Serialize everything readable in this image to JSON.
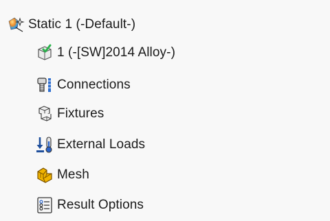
{
  "tree": {
    "root": {
      "label": "Static 1 (-Default-)",
      "icon": "static-study-icon"
    },
    "items": [
      {
        "label": "1 (-[SW]2014 Alloy-)",
        "icon": "part-material-check-icon"
      },
      {
        "label": "Connections",
        "icon": "connections-bolt-icon"
      },
      {
        "label": "Fixtures",
        "icon": "fixtures-icon"
      },
      {
        "label": "External Loads",
        "icon": "external-loads-icon"
      },
      {
        "label": "Mesh",
        "icon": "mesh-icon"
      },
      {
        "label": "Result Options",
        "icon": "result-options-icon"
      }
    ]
  },
  "colors": {
    "background": "#f8f8f8",
    "text": "#1a1a1a",
    "check_green": "#2bb24c",
    "load_blue": "#1f4f9c",
    "mesh_yellow": "#f0b400"
  }
}
